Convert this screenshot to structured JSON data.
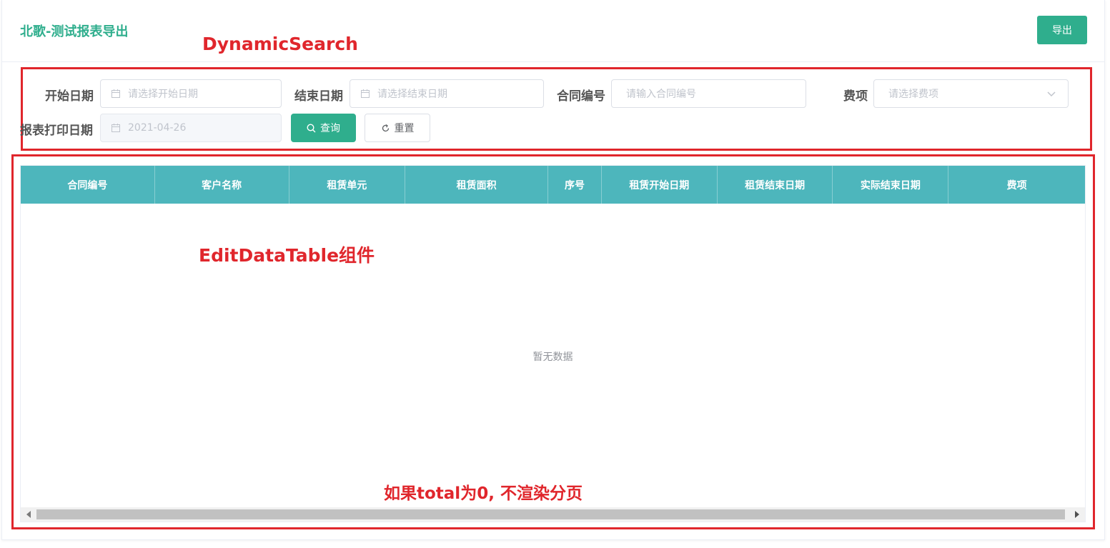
{
  "header": {
    "title": "北歌-测试报表导出",
    "export_label": "导出"
  },
  "annotations": {
    "search": "DynamicSearch",
    "table": "EditDataTable组件",
    "pager": "如果total为0, 不渲染分页"
  },
  "search": {
    "start_date": {
      "label": "开始日期",
      "placeholder": "请选择开始日期"
    },
    "end_date": {
      "label": "结束日期",
      "placeholder": "请选择结束日期"
    },
    "contract_no": {
      "label": "合同编号",
      "placeholder": "请输入合同编号"
    },
    "fee_item": {
      "label": "费项",
      "placeholder": "请选择费项"
    },
    "print_date": {
      "label": "报表打印日期",
      "value": "2021-04-26"
    },
    "query_label": "查询",
    "reset_label": "重置"
  },
  "table": {
    "columns": [
      "合同编号",
      "客户名称",
      "租赁单元",
      "租赁面积",
      "序号",
      "租赁开始日期",
      "租赁结束日期",
      "实际结束日期",
      "费项"
    ],
    "empty_text": "暂无数据"
  },
  "colors": {
    "primary": "#2fae8d",
    "table_header": "#4db6bc",
    "annotation": "#e0262c"
  }
}
